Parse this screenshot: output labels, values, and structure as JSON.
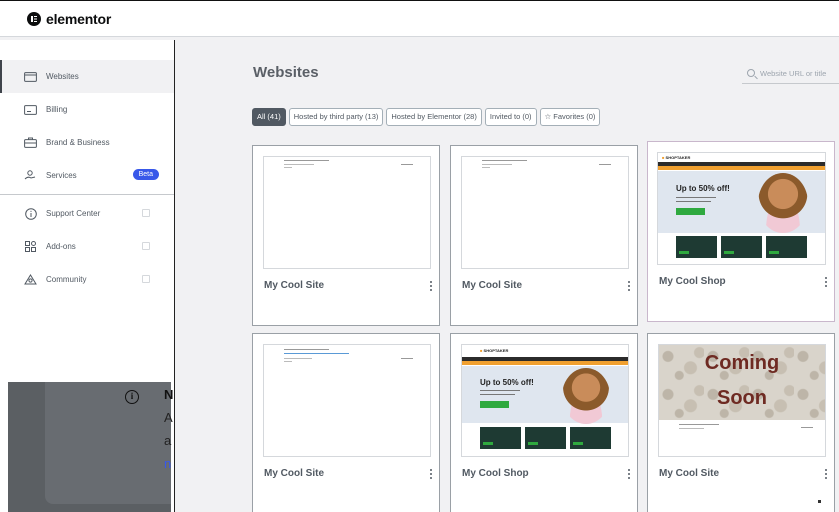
{
  "brand": {
    "name": "elementor"
  },
  "sidebar": {
    "items": [
      {
        "label": "Websites",
        "icon": "browser-window-icon"
      },
      {
        "label": "Billing",
        "icon": "billing-icon"
      },
      {
        "label": "Brand & Business",
        "icon": "briefcase-icon"
      },
      {
        "label": "Services",
        "icon": "services-hand-icon",
        "badge": "Beta"
      },
      {
        "label": "Support Center",
        "icon": "info-circle-icon"
      },
      {
        "label": "Add-ons",
        "icon": "addons-grid-icon"
      },
      {
        "label": "Community",
        "icon": "community-icon"
      }
    ]
  },
  "toast": {
    "title": "N",
    "lines": [
      "A",
      "a",
      "n"
    ]
  },
  "main": {
    "title": "Websites",
    "search_placeholder": "Website URL or title",
    "filters": [
      {
        "label": "All (41)",
        "active": true
      },
      {
        "label": "Hosted by third party (13)"
      },
      {
        "label": "Hosted by Elementor (28)"
      },
      {
        "label": "Invited to (0)"
      },
      {
        "label": "Favorites (0)",
        "icon": "star-icon"
      }
    ],
    "cards": [
      {
        "title": "My Cool Site",
        "thumb": "blank"
      },
      {
        "title": "My Cool Site",
        "thumb": "blank"
      },
      {
        "title": "My Cool Shop",
        "thumb": "shop"
      },
      {
        "title": "My Cool Site",
        "thumb": "blank-link"
      },
      {
        "title": "My Cool Shop",
        "thumb": "shop"
      },
      {
        "title": "My Cool Site",
        "thumb": "coming-soon"
      }
    ],
    "shop_thumb": {
      "brand": "SHOPTAKER",
      "headline": "Up to 50% off!"
    },
    "coming_soon_thumb": {
      "line1": "Coming",
      "line2": "Soon"
    }
  },
  "colors": {
    "accent": "#3858e9",
    "active_chip": "#515962",
    "sale_green": "#2fa93f"
  }
}
